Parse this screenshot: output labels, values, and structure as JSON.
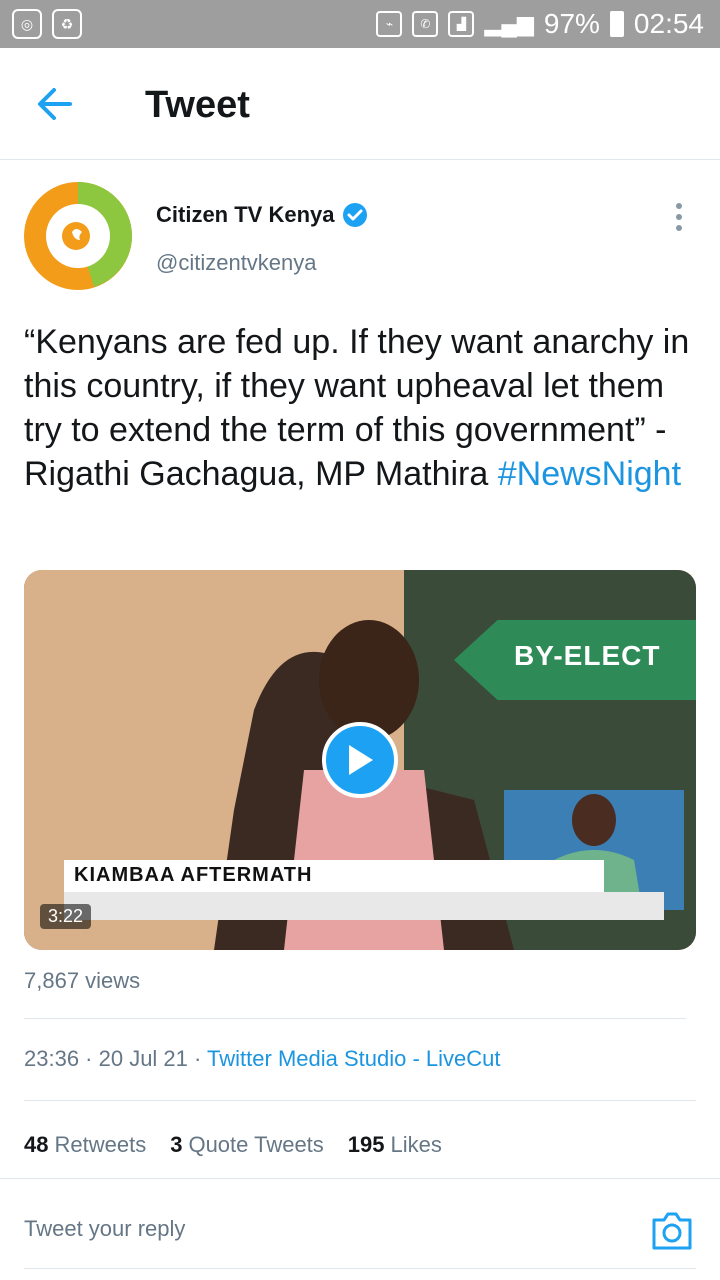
{
  "status_bar": {
    "battery": "97%",
    "time": "02:54"
  },
  "app_bar": {
    "title": "Tweet",
    "back_icon": "back-arrow-icon"
  },
  "tweet": {
    "author": {
      "name": "Citizen TV Kenya",
      "handle": "@citizentvkenya",
      "verified": true
    },
    "text": "“Kenyans are fed up. If they want anarchy in this country, if they want upheaval let them try to extend the term of this government” - Rigathi Gachagua, MP Mathira ",
    "hashtag": "#NewsNight",
    "media": {
      "duration": "3:22",
      "sign_text": "BY-ELECT",
      "lower_third": "KIAMBAA AFTERMATH"
    },
    "views": "7,867 views",
    "timestamp": "23:36 · 20 Jul 21 · ",
    "source": "Twitter Media Studio - LiveCut",
    "stats": {
      "retweets_count": "48",
      "retweets_label": "Retweets",
      "quotes_count": "3",
      "quotes_label": "Quote Tweets",
      "likes_count": "195",
      "likes_label": "Likes"
    }
  },
  "reply": {
    "placeholder": "Tweet your reply"
  },
  "colors": {
    "accent": "#1da1f2",
    "link": "#1b95e0",
    "text": "#14171a",
    "muted": "#657786"
  }
}
